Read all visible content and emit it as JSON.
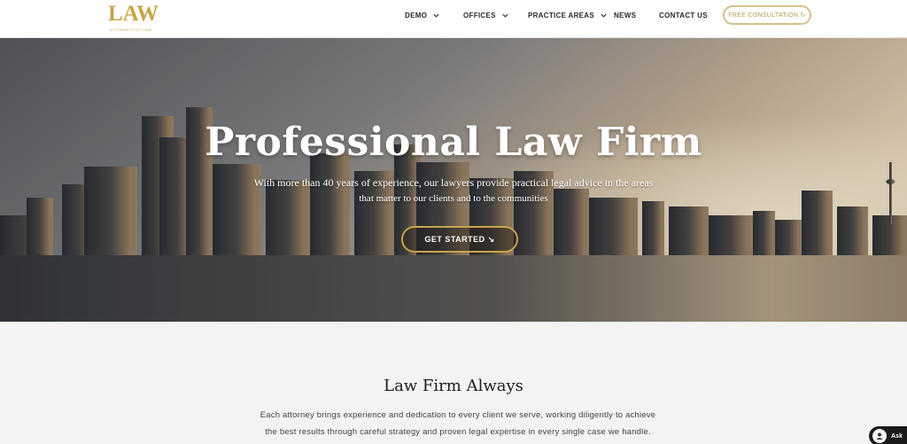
{
  "header": {
    "logo": {
      "text": "LAW",
      "tagline": "ATTORNEYS AT LAW"
    },
    "nav": [
      {
        "label": "DEMO",
        "has_dropdown": true
      },
      {
        "label": "OFFICES",
        "has_dropdown": true
      },
      {
        "label": "PRACTICE AREAS",
        "has_dropdown": true
      },
      {
        "label": "NEWS",
        "has_dropdown": false
      },
      {
        "label": "CONTACT US",
        "has_dropdown": false
      }
    ],
    "cta_label": "FREE CONSULTATION ↻"
  },
  "hero": {
    "title": "Professional Law Firm",
    "subtitle_line1": "With more than 40 years of experience, our lawyers provide practical legal advice in the areas",
    "subtitle_line2": "that matter to our clients and to the communities",
    "button_label": "GET STARTED ↘"
  },
  "section": {
    "title": "Law Firm Always",
    "text_line1": "Each attorney brings experience and dedication to every client we serve, working diligently to achieve",
    "text_line2": "the best results through careful strategy and proven legal expertise in every single case we handle."
  },
  "chat_widget": {
    "label": "Ask"
  },
  "colors": {
    "accent": "#c8a44a",
    "header_bg": "#ffffff",
    "section_bg": "#f3f3f3"
  }
}
